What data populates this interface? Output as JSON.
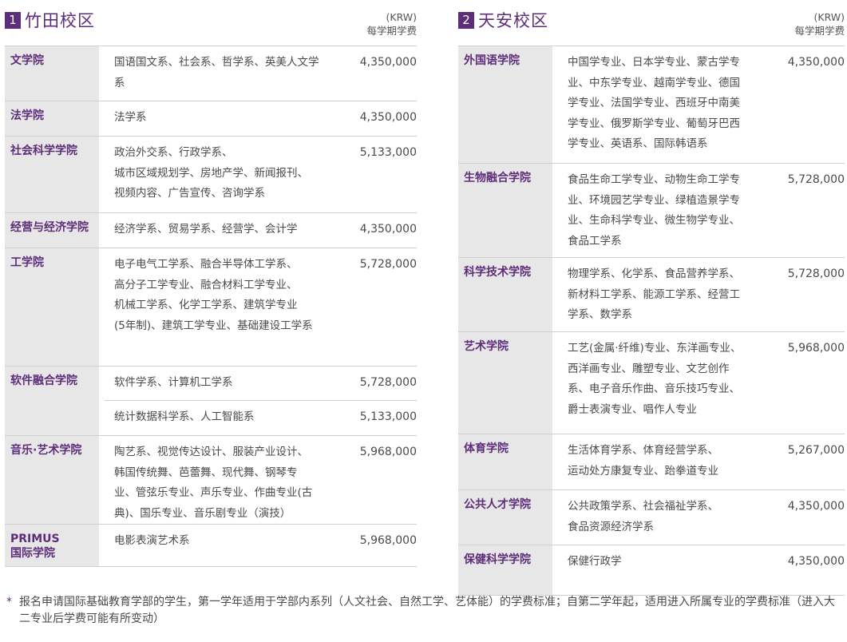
{
  "left": {
    "num": "1",
    "title": "竹田校区",
    "fee_unit": "(KRW)",
    "fee_label": "每学期学费",
    "faculties": [
      {
        "name": "文学院",
        "rows": [
          {
            "dept": "国语国文系、社会系、哲学系、英美人文学系",
            "fee": "4,350,000"
          }
        ]
      },
      {
        "name": "法学院",
        "rows": [
          {
            "dept": "法学系",
            "fee": "4,350,000"
          }
        ]
      },
      {
        "name": "社会科学学院",
        "rows": [
          {
            "dept": "政治外交系、行政学系、\n城市区域规划学、房地产学、新闻报刊、\n视频内容、广告宣传、咨询学系",
            "fee": "5,133,000"
          }
        ]
      },
      {
        "name": "经营与经济学院",
        "rows": [
          {
            "dept": "经济学系、贸易学系、经营学、会计学",
            "fee": "4,350,000"
          }
        ]
      },
      {
        "name": "工学院",
        "rows": [
          {
            "dept": "电子电气工学系、融合半导体工学系、\n高分子工学专业、融合材料工学专业、\n机械工学系、化学工学系、建筑学专业\n(5年制)、建筑工学专业、基础建设工学系",
            "fee": "5,728,000"
          }
        ]
      },
      {
        "name": "软件融合学院",
        "rows": [
          {
            "dept": "软件学系、计算机工学系",
            "fee": "5,728,000"
          },
          {
            "dept": "统计数据科学系、人工智能系",
            "fee": "5,133,000"
          }
        ]
      },
      {
        "name": "音乐·艺术学院",
        "rows": [
          {
            "dept": "陶艺系、视觉传达设计、服装产业设计、\n韩国传统舞、芭蕾舞、现代舞、钢琴专\n业、管弦乐专业、声乐专业、作曲专业(古\n典)、国乐专业、音乐剧专业（演技）",
            "fee": "5,968,000"
          }
        ]
      },
      {
        "name": "PRIMUS\n国际学院",
        "rows": [
          {
            "dept": "电影表演艺术系",
            "fee": "5,968,000"
          }
        ]
      }
    ]
  },
  "right": {
    "num": "2",
    "title": "天安校区",
    "fee_unit": "(KRW)",
    "fee_label": "每学期学费",
    "faculties": [
      {
        "name": "外国语学院",
        "rows": [
          {
            "dept": "中国学专业、日本学专业、蒙古学专\n业、中东学专业、越南学专业、德国\n学专业、法国学专业、西班牙中南美\n学专业、俄罗斯学专业、葡萄牙巴西\n学专业、英语系、国际韩语系",
            "fee": "4,350,000"
          }
        ]
      },
      {
        "name": "生物融合学院",
        "rows": [
          {
            "dept": "食品生命工学专业、动物生命工学专\n业、环境园艺学专业、绿植造景学专\n业、生命科学专业、微生物学专业、\n食品工学系",
            "fee": "5,728,000"
          }
        ]
      },
      {
        "name": "科学技术学院",
        "rows": [
          {
            "dept": "物理学系、化学系、食品营养学系、\n新材料工学系、能源工学系、经营工\n学系、数学系",
            "fee": "5,728,000"
          }
        ]
      },
      {
        "name": "艺术学院",
        "rows": [
          {
            "dept": "工艺(金属·纤维)专业、东洋画专业、\n西洋画专业、雕塑专业、文艺创作\n系、电子音乐作曲、音乐技巧专业、\n爵士表演专业、唱作人专业",
            "fee": "5,968,000"
          }
        ]
      },
      {
        "name": "体育学院",
        "rows": [
          {
            "dept": "生活体育学系、体育经营学系、\n运动处方康复专业、跆拳道专业",
            "fee": "5,267,000"
          }
        ]
      },
      {
        "name": "公共人才学院",
        "rows": [
          {
            "dept": "公共政策学系、社会福祉学系、\n食品资源经济学系",
            "fee": "4,350,000"
          }
        ]
      },
      {
        "name": "保健科学学院",
        "rows": [
          {
            "dept": "保健行政学",
            "fee": "4,350,000"
          }
        ]
      }
    ]
  },
  "footnote": {
    "star": "*",
    "text": "报名申请国际基础教育学部的学生，第一学年适用于学部内系列（人文社会、自然工学、艺体能）的学费标准；自第二学年起，适用进入所属专业的学费标准（进入大二专业后学费可能有所变动）"
  }
}
